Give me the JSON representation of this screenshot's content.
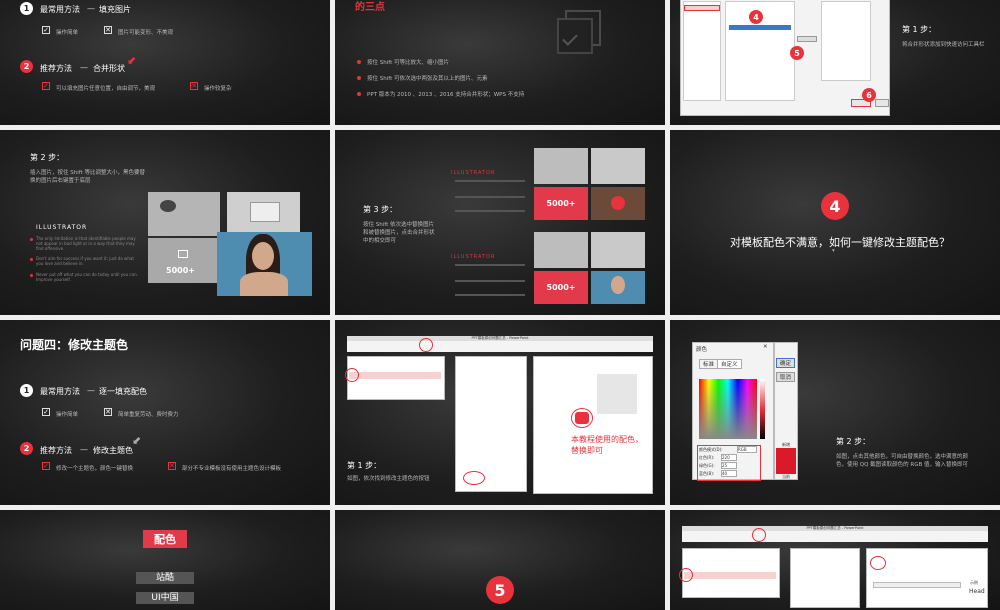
{
  "colors": {
    "accent": "#e8323c",
    "bg": "#1e1e1e"
  },
  "s1": {
    "item1": {
      "num": "1",
      "title": "最常用方法",
      "dash": "—",
      "method": "填充图片",
      "pro": "操作简单",
      "con": "图片可能变形、不美观"
    },
    "item2": {
      "num": "2",
      "title": "推荐方法",
      "dash": "—",
      "method": "合并形状",
      "pro": "可以填充图片任意位置，自由调节，美观",
      "con": "操作较复杂"
    }
  },
  "s2": {
    "title": "的三点",
    "bullets": [
      "按住 Shift 可等比放大、缩小图片",
      "按住 Shift 可依次选中两张及其以上的图片、元素",
      "PPT 版本为 2010 、2013 、2016 支持合并形状；WPS 不支持"
    ]
  },
  "s3": {
    "step": "第 1 步：",
    "desc": "将合并形状添加到快速访问工具栏",
    "markers": [
      "4",
      "5",
      "6"
    ]
  },
  "s4": {
    "step": "第 2 步：",
    "desc": "插入图片，按住 Shift 等比调整大小，黑色要替换的图片后右键置于底层",
    "heading": "ILLUSTRATOR",
    "bullets": [
      "The only limitation is that identifiable people may not appear in bad light or in a way that they may find offensive.",
      "Don't aim for success if you want it; just do what you love and believe in.",
      "Never put off what you can do today until you can. Improve yourself."
    ],
    "badge": "5000+"
  },
  "s5": {
    "step": "第 3 步：",
    "desc": "按住 Shift 依次选中替换图片和被替换图片，点击合并形状中的相交即可",
    "heading": "ILLUSTRATOR",
    "badge": "5000+"
  },
  "s6": {
    "num": "4",
    "question": "对模板配色不满意，如何一键修改主题配色？"
  },
  "s7": {
    "title": "问题四：修改主题色",
    "item1": {
      "num": "1",
      "title": "最常用方法",
      "dash": "—",
      "method": "逐一填充配色",
      "pro": "操作简单",
      "con": "简单重复劳动、费时费力"
    },
    "item2": {
      "num": "2",
      "title": "推荐方法",
      "dash": "—",
      "method": "修改主题色",
      "pro": "修改一个主题色，颜色一键替换",
      "con": "部分不专业模板没有使用主题色设计模板"
    }
  },
  "s8": {
    "titlebar": "PPT模板原创问题汇总 - PowerPoint",
    "step": "第 1 步：",
    "desc": "如图，依次找到修改主题色的按钮",
    "note": "本教程使用的配色，替换即可"
  },
  "s9": {
    "dialog_title": "颜色",
    "tabs": [
      "标准",
      "自定义"
    ],
    "ok": "确定",
    "cancel": "取消",
    "mode_label": "颜色模式(D):",
    "mode_value": "RGB",
    "red_label": "红色(R):",
    "red_value": "220",
    "green_label": "绿色(G):",
    "green_value": "25",
    "blue_label": "蓝色(B):",
    "blue_value": "40",
    "new_label": "新增",
    "current_label": "当前",
    "step": "第 2 步：",
    "desc": "如图，点击其他颜色，可自由替换颜色，选中满意的颜色，使用 QQ 截图读取颜色的 RGB 值，输入替换即可"
  },
  "s10": {
    "label": "配色",
    "options": [
      "站酷",
      "UI中国"
    ]
  },
  "s11": {
    "num": "5"
  },
  "s12": {
    "titlebar": "PPT模板原创问题汇总 - PowerPoint",
    "preview": "Head",
    "panel": "示例"
  }
}
